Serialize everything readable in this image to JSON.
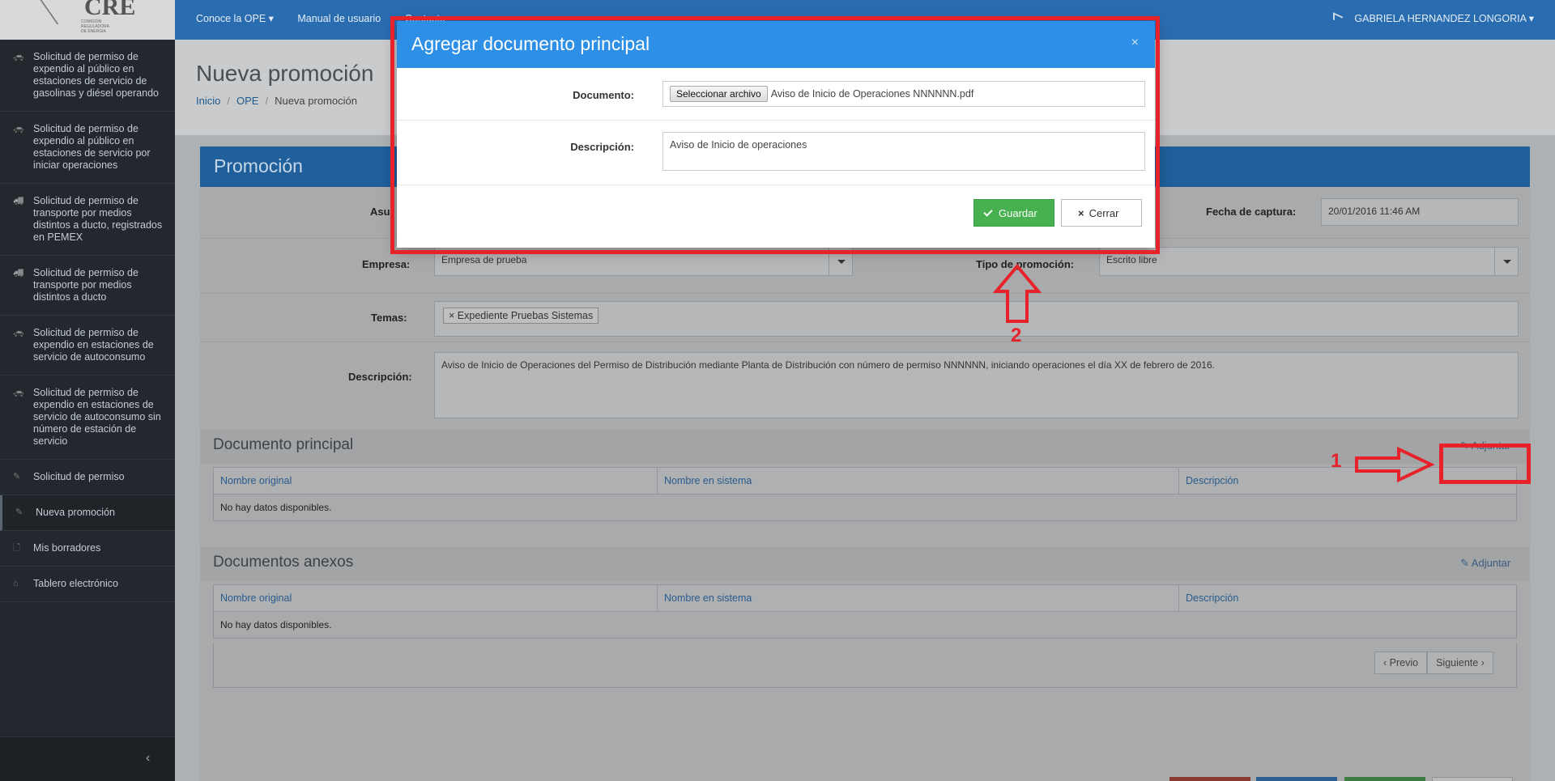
{
  "logo": {
    "text": "CRE",
    "subtitle": "COMISIÓN REGULADORA DE ENERGÍA"
  },
  "sidebar": {
    "items": [
      {
        "label": "Solicitud de permiso de expendio al público en estaciones de servicio de gasolinas y diésel operando",
        "icon": "car-icon"
      },
      {
        "label": "Solicitud de permiso de expendio al público en estaciones de servicio por iniciar operaciones",
        "icon": "car-icon"
      },
      {
        "label": "Solicitud de permiso de transporte por medios distintos a ducto, registrados en PEMEX",
        "icon": "truck-icon"
      },
      {
        "label": "Solicitud de permiso de transporte por medios distintos a ducto",
        "icon": "truck-icon"
      },
      {
        "label": "Solicitud de permiso de expendio en estaciones de servicio de autoconsumo",
        "icon": "car-icon"
      },
      {
        "label": "Solicitud de permiso de expendio en estaciones de servicio de autoconsumo sin número de estación de servicio",
        "icon": "car-icon"
      },
      {
        "label": "Solicitud de permiso",
        "icon": "pencil-icon"
      },
      {
        "label": "Nueva promoción",
        "icon": "pencil-icon"
      },
      {
        "label": "Mis borradores",
        "icon": "file-icon"
      },
      {
        "label": "Tablero electrónico",
        "icon": "inbox-icon"
      }
    ],
    "collapse_glyph": "‹"
  },
  "topbar": {
    "nav": [
      "Conoce la OPE ▾",
      "Manual de usuario",
      "Contacto"
    ],
    "user": "GABRIELA HERNANDEZ LONGORIA ▾"
  },
  "page": {
    "title": "Nueva promoción",
    "breadcrumb": [
      "Inicio",
      "OPE",
      "Nueva promoción"
    ],
    "panel_title": "Promoción"
  },
  "form": {
    "asunto_label": "Asu",
    "fecha_label": "Fecha de captura:",
    "fecha_value": "20/01/2016 11:46 AM",
    "empresa_label": "Empresa:",
    "empresa_value": "Empresa de prueba",
    "tipo_label": "Tipo de promoción:",
    "tipo_value": "Escrito libre",
    "temas_label": "Temas:",
    "temas_tag": "Expediente Pruebas Sistemas",
    "temas_tag_remove": "×",
    "descripcion_label": "Descripción:",
    "descripcion_value": "Aviso de Inicio de Operaciones del Permiso de Distribución mediante Planta de Distribución  con número de permiso NNNNNN, iniciando operaciones el día XX de febrero de 2016."
  },
  "documento_principal": {
    "title": "Documento principal",
    "attach_label": "Adjuntar",
    "columns": [
      "Nombre original",
      "Nombre en sistema",
      "Descripción"
    ],
    "empty": "No hay datos disponibles."
  },
  "documentos_anexos": {
    "title": "Documentos anexos",
    "attach_label": "Adjuntar",
    "columns": [
      "Nombre original",
      "Nombre en sistema",
      "Descripción"
    ],
    "empty": "No hay datos disponibles.",
    "prev": "‹ Previo",
    "next": "Siguiente ›"
  },
  "modal": {
    "title": "Agregar documento principal",
    "close_glyph": "×",
    "documento_label": "Documento:",
    "file_button": "Seleccionar archivo",
    "file_name": "Aviso de Inicio de Operaciones NNNNNN.pdf",
    "descripcion_label": "Descripción:",
    "descripcion_value": "Aviso de Inicio de operaciones",
    "save_label": "Guardar",
    "close_label": "Cerrar"
  },
  "annotations": {
    "step1": "1",
    "step2": "2",
    "color": "#e8222a"
  }
}
